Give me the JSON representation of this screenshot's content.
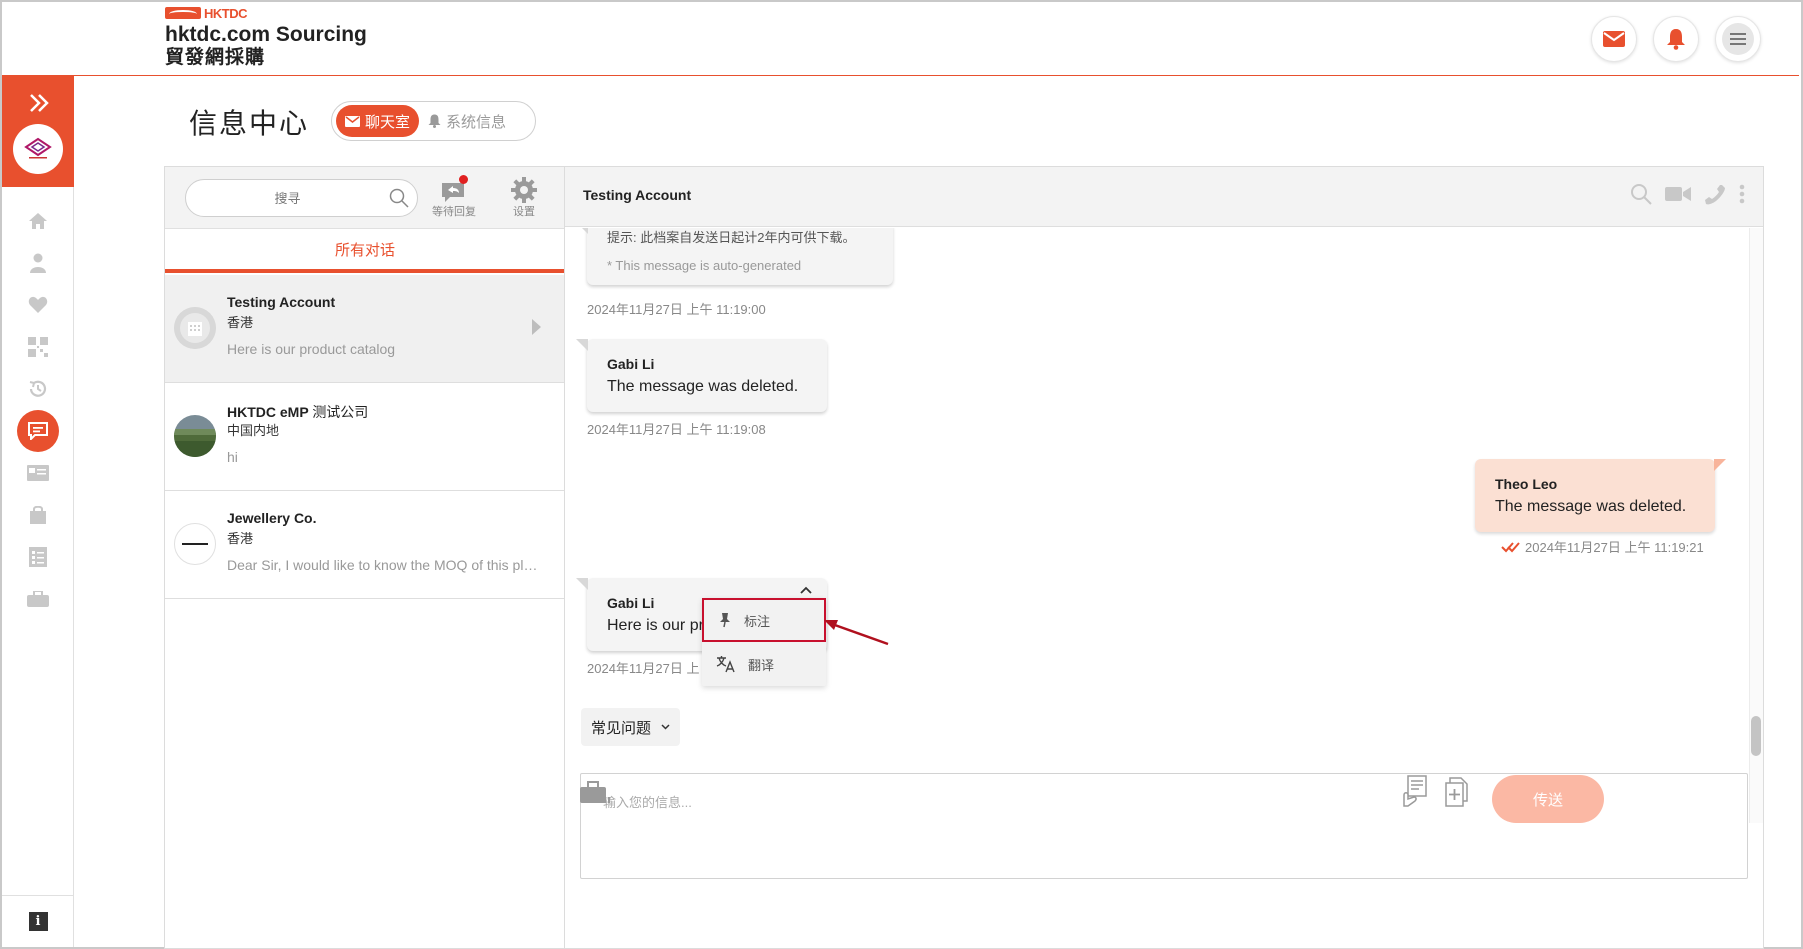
{
  "header": {
    "brand_small": "HKTDC",
    "brand_en": "hktdc.com Sourcing",
    "brand_zh": "貿發網採購"
  },
  "page": {
    "title": "信息中心",
    "tabs": [
      {
        "label": "聊天室",
        "active": true
      },
      {
        "label": "系统信息",
        "active": false
      }
    ]
  },
  "list": {
    "search_placeholder": "搜寻",
    "tool_pending": "等待回复",
    "tool_settings": "设置",
    "filter_label": "所有对话",
    "conversations": [
      {
        "name": "Testing Account",
        "name_cn": "",
        "region": "香港",
        "preview": "Here is our product catalog",
        "selected": true
      },
      {
        "name": "HKTDC eMP ",
        "name_cn": "测试公司",
        "region": "中国内地",
        "preview": "hi",
        "selected": false
      },
      {
        "name": "Jewellery Co.",
        "name_cn": "",
        "region": "香港",
        "preview": "Dear Sir, I would like to know the MOQ of this plat...",
        "selected": false
      }
    ]
  },
  "chat": {
    "title": "Testing Account",
    "system_msg": {
      "line1": "提示: 此档案自发送日起计2年内可供下载。",
      "line2": "* This message is auto-generated",
      "time": "2024年11月27日 上午 11:19:00"
    },
    "msg1": {
      "sender": "Gabi Li",
      "body": "The message was deleted.",
      "time": "2024年11月27日 上午 11:19:08"
    },
    "msg2": {
      "sender": "Theo Leo",
      "body": "The message was deleted.",
      "time": "2024年11月27日 上午 11:19:21"
    },
    "msg3": {
      "sender": "Gabi Li",
      "body": "Here is our pr",
      "time": "2024年11月27日 上"
    },
    "context_menu": {
      "pin_label": "标注",
      "translate_label": "翻译"
    },
    "faq_label": "常见问题",
    "input_placeholder": "输入您的信息...",
    "send_label": "传送"
  },
  "colors": {
    "accent": "#e8502e",
    "send_disabled": "#fbb8a4",
    "outgoing_bubble": "#fbe0d3",
    "highlight_border": "#c8102e"
  }
}
